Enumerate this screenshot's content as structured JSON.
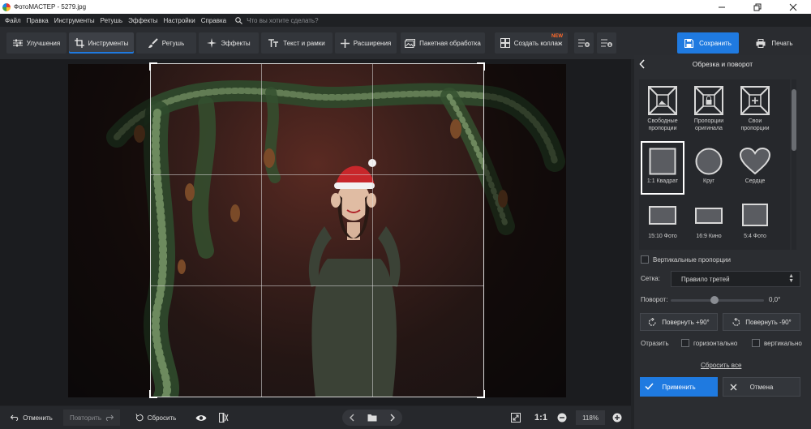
{
  "window": {
    "title": "ФотоМАСТЕР - 5279.jpg"
  },
  "menu": {
    "items": [
      "Файл",
      "Правка",
      "Инструменты",
      "Ретушь",
      "Эффекты",
      "Настройки",
      "Справка"
    ],
    "search_placeholder": "Что вы хотите сделать?"
  },
  "toolbar": {
    "tabs": [
      "Улучшения",
      "Инструменты",
      "Ретушь",
      "Эффекты",
      "Текст и рамки",
      "Расширения",
      "Пакетная обработка",
      "Создать коллаж"
    ],
    "active_tab": "Инструменты",
    "new_badge": "NEW",
    "save_label": "Сохранить",
    "print_label": "Печать",
    "accent_color": "#1f7ae0"
  },
  "panel": {
    "title": "Обрезка и поворот",
    "shapes": [
      {
        "line1": "Свободные",
        "line2": "пропорции",
        "icon": "free-crop-icon"
      },
      {
        "line1": "Пропорции",
        "line2": "оригинала",
        "icon": "lock-crop-icon"
      },
      {
        "line1": "Свои",
        "line2": "пропорции",
        "icon": "custom-crop-icon"
      },
      {
        "line1": "1:1 Квадрат",
        "line2": "",
        "icon": "square-icon"
      },
      {
        "line1": "Круг",
        "line2": "",
        "icon": "circle-icon"
      },
      {
        "line1": "Сердце",
        "line2": "",
        "icon": "heart-icon"
      },
      {
        "line1": "15:10 Фото",
        "line2": "",
        "icon": "ratio-15-10-icon"
      },
      {
        "line1": "16:9 Кино",
        "line2": "",
        "icon": "ratio-16-9-icon"
      },
      {
        "line1": "5:4 Фото",
        "line2": "",
        "icon": "ratio-5-4-icon"
      }
    ],
    "selected_shape": "1:1 Квадрат",
    "vertical_label": "Вертикальные пропорции",
    "grid_label": "Сетка:",
    "grid_value": "Правило третей",
    "rotation_label": "Поворот:",
    "rotation_value": "0,0°",
    "rotation_degrees": 0,
    "rotate_plus": "Повернуть +90°",
    "rotate_minus": "Повернуть -90°",
    "flip_label": "Отразить",
    "flip_h": "горизонтально",
    "flip_v": "вертикально",
    "reset_all": "Сбросить все",
    "apply": "Применить",
    "cancel": "Отмена"
  },
  "bottom": {
    "undo": "Отменить",
    "redo": "Повторить",
    "reset": "Сбросить",
    "zoom_ratio": "1:1",
    "zoom_value": "118%"
  }
}
